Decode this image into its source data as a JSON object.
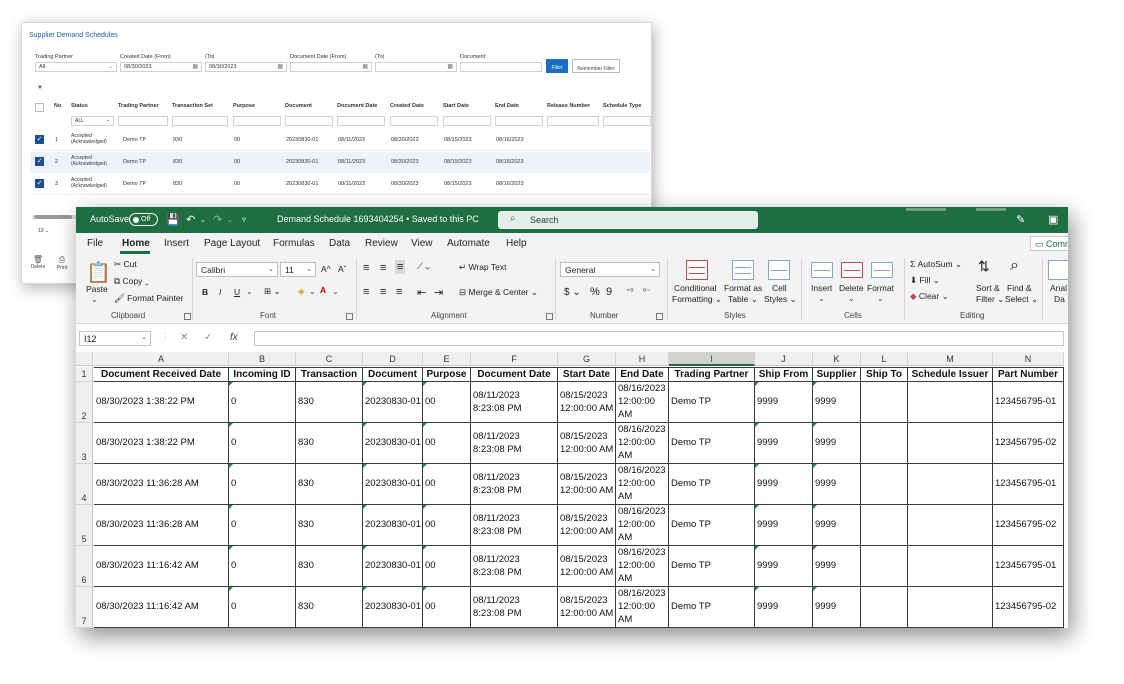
{
  "portal": {
    "title": "Supplier Demand Schedules",
    "filters": [
      {
        "label": "Trading Partner",
        "value": "All",
        "icon": "chevron-down-icon"
      },
      {
        "label": "Created Date (From)",
        "value": "08/30/2023",
        "icon": "calendar-icon"
      },
      {
        "label": "(To)",
        "value": "08/30/2023",
        "icon": "calendar-icon"
      },
      {
        "label": "Document Date (From)",
        "value": "",
        "icon": "calendar-icon"
      },
      {
        "label": "(To)",
        "value": "",
        "icon": "calendar-icon"
      },
      {
        "label": "Document",
        "value": "",
        "icon": ""
      }
    ],
    "filter_button": "Filter",
    "remember_button": "Remember Filter",
    "columns": [
      "No",
      "Status",
      "Trading Partner",
      "Transaction Set",
      "Purpose",
      "Document",
      "Document Date",
      "Created Date",
      "Start Date",
      "End Date",
      "Release Number",
      "Schedule Type"
    ],
    "status_filter": "ALL",
    "rows": [
      {
        "no": "1",
        "status": "Accepted (Acknowledged)",
        "partner": "Demo TP",
        "set": "830",
        "purpose": "00",
        "document": "20230830-01",
        "doc_date": "08/11/2023",
        "created": "08/30/2023",
        "start": "08/15/2023",
        "end": "08/16/2023"
      },
      {
        "no": "2",
        "status": "Accepted (Acknowledged)",
        "partner": "Demo TP",
        "set": "830",
        "purpose": "00",
        "document": "20230830-01",
        "doc_date": "08/11/2023",
        "created": "08/30/2023",
        "start": "08/15/2023",
        "end": "08/16/2023"
      },
      {
        "no": "3",
        "status": "Accepted (Acknowledged)",
        "partner": "Demo TP",
        "set": "830",
        "purpose": "00",
        "document": "20230830-01",
        "doc_date": "08/11/2023",
        "created": "08/30/2023",
        "start": "08/15/2023",
        "end": "08/16/2023"
      }
    ],
    "page_size": "10",
    "actions": [
      {
        "label": "Delete",
        "icon": "trash-icon"
      },
      {
        "label": "Print",
        "icon": "printer-icon"
      }
    ]
  },
  "excel": {
    "autosave_label": "AutoSave",
    "autosave_state": "Off",
    "file_title": "Demand Schedule 1693404254  •  Saved to this PC",
    "search_placeholder": "Search",
    "menu": [
      "File",
      "Home",
      "Insert",
      "Page Layout",
      "Formulas",
      "Data",
      "Review",
      "View",
      "Automate",
      "Help"
    ],
    "active_tab": "Home",
    "comments_button": "Comm",
    "ribbon": {
      "clipboard": {
        "label": "Clipboard",
        "paste": "Paste",
        "cut": "Cut",
        "copy": "Copy",
        "format_painter": "Format Painter"
      },
      "font": {
        "label": "Font",
        "name": "Calibri",
        "size": "11",
        "grow": "A^",
        "shrink": "Aˇ",
        "bold": "B",
        "italic": "I",
        "underline": "U"
      },
      "alignment": {
        "label": "Alignment",
        "wrap": "Wrap Text",
        "merge": "Merge & Center"
      },
      "number": {
        "label": "Number",
        "format": "General",
        "currency": "$",
        "percent": "%",
        "comma": "9"
      },
      "styles": {
        "label": "Styles",
        "conditional": [
          "Conditional",
          "Formatting"
        ],
        "format_table": [
          "Format as",
          "Table"
        ],
        "cell_styles": [
          "Cell",
          "Styles"
        ]
      },
      "cells": {
        "label": "Cells",
        "insert": "Insert",
        "delete": "Delete",
        "format": "Format"
      },
      "editing": {
        "label": "Editing",
        "autosum": "AutoSum",
        "fill": "Fill",
        "clear": "Clear",
        "sort": [
          "Sort &",
          "Filter"
        ],
        "find": [
          "Find &",
          "Select"
        ]
      },
      "analyze": [
        "Anal",
        "Da"
      ]
    },
    "name_box": "I12",
    "formula_icons": [
      "✕",
      "✓",
      "fx"
    ],
    "selected_column": "I",
    "column_letters": [
      "A",
      "B",
      "C",
      "D",
      "E",
      "F",
      "G",
      "H",
      "I",
      "J",
      "K",
      "L",
      "M",
      "N"
    ],
    "headers": [
      "Document Received Date",
      "Incoming ID",
      "Transaction",
      "Document",
      "Purpose",
      "Document Date",
      "Start Date",
      "End Date",
      "Trading Partner",
      "Ship From",
      "Supplier",
      "Ship To",
      "Schedule Issuer",
      "Part Number"
    ],
    "rows": [
      {
        "n": "2",
        "cells": [
          "08/30/2023 1:38:22 PM",
          "0",
          "830",
          "20230830-01",
          "00",
          [
            "08/11/2023",
            "8:23:08 PM"
          ],
          [
            "08/15/2023",
            "12:00:00 AM"
          ],
          [
            "08/16/2023",
            "12:00:00",
            "AM"
          ],
          "Demo TP",
          "9999",
          "9999",
          "",
          "",
          "123456795-01"
        ]
      },
      {
        "n": "3",
        "cells": [
          "08/30/2023 1:38:22 PM",
          "0",
          "830",
          "20230830-01",
          "00",
          [
            "08/11/2023",
            "8:23:08 PM"
          ],
          [
            "08/15/2023",
            "12:00:00 AM"
          ],
          [
            "08/16/2023",
            "12:00:00",
            "AM"
          ],
          "Demo TP",
          "9999",
          "9999",
          "",
          "",
          "123456795-02"
        ]
      },
      {
        "n": "4",
        "cells": [
          "08/30/2023 11:36:28 AM",
          "0",
          "830",
          "20230830-01",
          "00",
          [
            "08/11/2023",
            "8:23:08 PM"
          ],
          [
            "08/15/2023",
            "12:00:00 AM"
          ],
          [
            "08/16/2023",
            "12:00:00",
            "AM"
          ],
          "Demo TP",
          "9999",
          "9999",
          "",
          "",
          "123456795-01"
        ]
      },
      {
        "n": "5",
        "cells": [
          "08/30/2023 11:36:28 AM",
          "0",
          "830",
          "20230830-01",
          "00",
          [
            "08/11/2023",
            "8:23:08 PM"
          ],
          [
            "08/15/2023",
            "12:00:00 AM"
          ],
          [
            "08/16/2023",
            "12:00:00",
            "AM"
          ],
          "Demo TP",
          "9999",
          "9999",
          "",
          "",
          "123456795-02"
        ]
      },
      {
        "n": "6",
        "cells": [
          "08/30/2023 11:16:42 AM",
          "0",
          "830",
          "20230830-01",
          "00",
          [
            "08/11/2023",
            "8:23:08 PM"
          ],
          [
            "08/15/2023",
            "12:00:00 AM"
          ],
          [
            "08/16/2023",
            "12:00:00",
            "AM"
          ],
          "Demo TP",
          "9999",
          "9999",
          "",
          "",
          "123456795-01"
        ]
      },
      {
        "n": "7",
        "cells": [
          "08/30/2023 11:16:42 AM",
          "0",
          "830",
          "20230830-01",
          "00",
          [
            "08/11/2023",
            "8:23:08 PM"
          ],
          [
            "08/15/2023",
            "12:00:00 AM"
          ],
          [
            "08/16/2023",
            "12:00:00",
            "AM"
          ],
          "Demo TP",
          "9999",
          "9999",
          "",
          "",
          "123456795-02"
        ]
      }
    ],
    "header_row_number": "1",
    "accent_color": "#1f6e43"
  }
}
